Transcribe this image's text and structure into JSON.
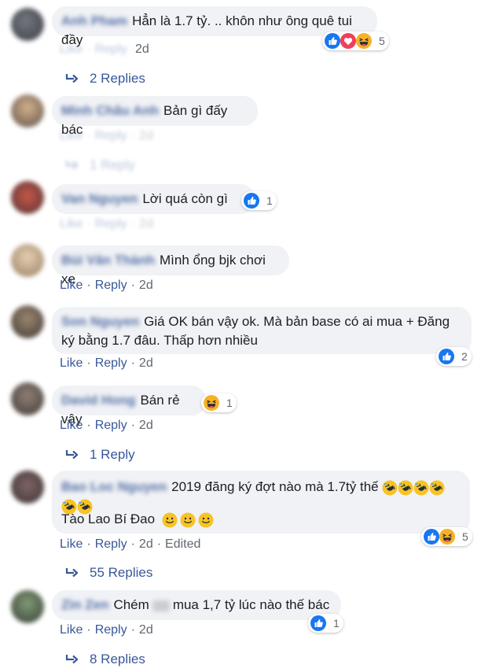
{
  "colors": {
    "link": "#385898",
    "meta": "#606770",
    "bubble": "#f0f2f5",
    "like_blue": "#1877f2",
    "love_red": "#f33e58",
    "haha_yellow": "#f7b125"
  },
  "comments": [
    {
      "author": "Anh Pham",
      "text": "Hẳn là 1.7 tỷ. .. khôn như ông quê tui đầy",
      "actions": {
        "like": "Like",
        "reply": "Reply",
        "time": "2d"
      },
      "reaction": {
        "icons": [
          "like-icon",
          "love-icon",
          "haha-icon"
        ],
        "count": "5"
      },
      "replies": "2 Replies"
    },
    {
      "author": "Minh Châu Anh",
      "text": "Bản gì đấy bác",
      "actions": {
        "like": "Like",
        "reply": "Reply",
        "time": "2d"
      },
      "replies": "1 Reply"
    },
    {
      "author": "Van Nguyen",
      "text": "Lời quá còn gì",
      "actions": {
        "like": "Like",
        "reply": "Reply",
        "time": "2d"
      },
      "reaction": {
        "icons": [
          "like-icon"
        ],
        "count": "1"
      }
    },
    {
      "author": "Bùi Văn Thành",
      "text": "Mình ổng bjk chơi xe",
      "actions": {
        "like": "Like",
        "reply": "Reply",
        "time": "2d"
      }
    },
    {
      "author": "Son Nguyen",
      "text_line1": "Giá OK bán vậy ok. Mà bản base có ai mua + Đăng",
      "text_line2": "ký bằng 1.7 đâu. Thấp hơn nhiều",
      "actions": {
        "like": "Like",
        "reply": "Reply",
        "time": "2d"
      },
      "reaction": {
        "icons": [
          "like-icon"
        ],
        "count": "2"
      }
    },
    {
      "author": "David Hong",
      "text": "Bán rẻ vậy",
      "actions": {
        "like": "Like",
        "reply": "Reply",
        "time": "2d"
      },
      "reaction": {
        "icons": [
          "haha-icon"
        ],
        "count": "1"
      },
      "replies": "1 Reply"
    },
    {
      "author": "Bao Loc Nguyen",
      "text_line1": "2019 đăng ký đợt nào mà 1.7tỷ thế",
      "text_line2": "Tào Lao Bí Đao",
      "actions": {
        "like": "Like",
        "reply": "Reply",
        "time": "2d",
        "edited": "Edited"
      },
      "reaction": {
        "icons": [
          "like-icon",
          "haha-icon"
        ],
        "count": "5"
      },
      "replies": "55 Replies"
    },
    {
      "author": "Zin Zen",
      "text_before": "Chém",
      "text_after": "mua 1,7 tỷ lúc nào thế bác",
      "actions": {
        "like": "Like",
        "reply": "Reply",
        "time": "2d"
      },
      "reaction": {
        "icons": [
          "like-icon"
        ],
        "count": "1"
      },
      "replies": "8 Replies"
    }
  ]
}
